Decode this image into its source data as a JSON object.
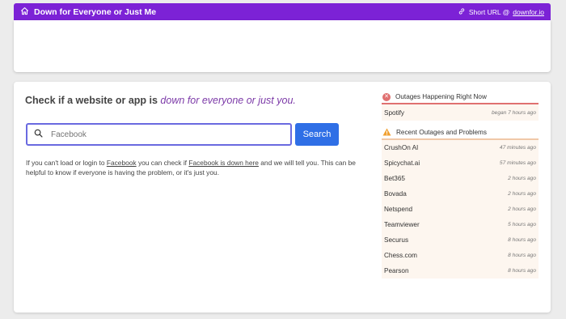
{
  "header": {
    "title": "Down for Everyone or Just Me",
    "short_url_label": "Short URL @ ",
    "short_url": "downfor.io"
  },
  "main": {
    "headline_start": "Check if a website or app is ",
    "headline_em": "down for everyone or just you.",
    "search_placeholder": "Facebook",
    "search_button": "Search",
    "desc_1": "If you can't load or login to ",
    "desc_link1": "Facebook",
    "desc_2": " you can check if ",
    "desc_link2": "Facebook is down here",
    "desc_3": " and we will tell you. This can be helpful to know if everyone is having the problem, or it's just you."
  },
  "sidebar": {
    "current_title": "Outages Happening Right Now",
    "current": [
      {
        "name": "Spotify",
        "time": "began 7 hours ago"
      }
    ],
    "recent_title": "Recent Outages and Problems",
    "recent": [
      {
        "name": "CrushOn AI",
        "time": "47 minutes ago"
      },
      {
        "name": "Spicychat.ai",
        "time": "57 minutes ago"
      },
      {
        "name": "Bet365",
        "time": "2 hours ago"
      },
      {
        "name": "Bovada",
        "time": "2 hours ago"
      },
      {
        "name": "Netspend",
        "time": "2 hours ago"
      },
      {
        "name": "Teamviewer",
        "time": "5 hours ago"
      },
      {
        "name": "Securus",
        "time": "8 hours ago"
      },
      {
        "name": "Chess.com",
        "time": "8 hours ago"
      },
      {
        "name": "Pearson",
        "time": "8 hours ago"
      }
    ]
  },
  "colors": {
    "header_bg": "#7c22d6",
    "accent_purple": "#7c3aa8",
    "button_blue": "#2f6fe6",
    "outage_red": "#e07070",
    "warning_orange": "#f0a030"
  },
  "icons": {
    "home": "home-icon",
    "link": "link-icon",
    "search": "search-icon",
    "outage": "x-circle-icon",
    "warning": "warning-icon"
  }
}
